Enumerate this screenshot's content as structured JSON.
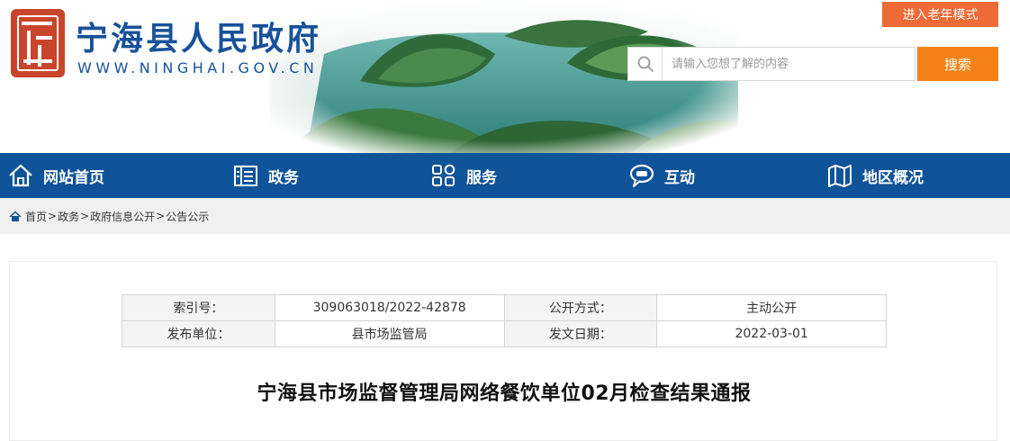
{
  "header": {
    "site_title": "宁海县人民政府",
    "site_url": "WWW.NINGHAI.GOV.CN",
    "elder_mode_label": "进入老年模式",
    "search_placeholder": "请输入您想了解的内容",
    "search_button_label": "搜索",
    "colors": {
      "brand_blue": "#17519a",
      "orange": "#f48217",
      "elder_orange": "#ee6a36"
    }
  },
  "nav": {
    "items": [
      {
        "label": "网站首页",
        "icon": "home-icon"
      },
      {
        "label": "政务",
        "icon": "document-icon"
      },
      {
        "label": "服务",
        "icon": "grid-icon"
      },
      {
        "label": "互动",
        "icon": "chat-icon"
      },
      {
        "label": "地区概况",
        "icon": "map-icon"
      }
    ],
    "color": "#0f5399"
  },
  "breadcrumb": {
    "items": [
      "首页",
      "政务",
      "政府信息公开",
      "公告公示"
    ],
    "separator": ">"
  },
  "meta_table": {
    "rows": [
      [
        {
          "key": "索引号：",
          "value": "309063018/2022-42878"
        },
        {
          "key": "公开方式：",
          "value": "主动公开"
        }
      ],
      [
        {
          "key": "发布单位：",
          "value": "县市场监管局"
        },
        {
          "key": "发文日期：",
          "value": "2022-03-01"
        }
      ]
    ]
  },
  "article": {
    "title": "宁海县市场监督管理局网络餐饮单位02月检查结果通报"
  }
}
